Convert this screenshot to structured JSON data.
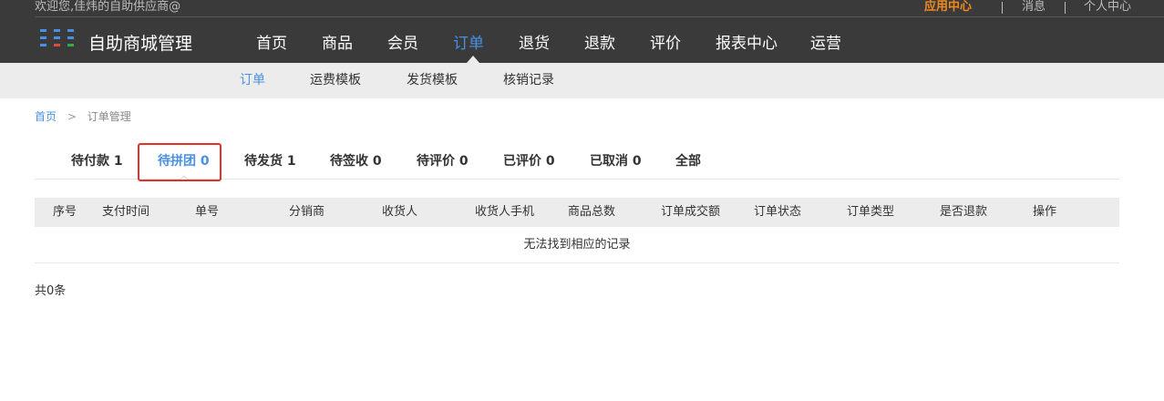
{
  "header": {
    "welcome": "欢迎您,佳炜的自助供应商@",
    "links": {
      "app_center": "应用中心",
      "messages": "消息",
      "personal_center": "个人中心"
    },
    "brand": "自助商城管理",
    "logo_colors": [
      "#4a90e2",
      "#4a90e2",
      "#4a90e2",
      "#e04b3a",
      "#3aa64a",
      "#4a90e2"
    ]
  },
  "main_nav": {
    "items": [
      "首页",
      "商品",
      "会员",
      "订单",
      "退货",
      "退款",
      "评价",
      "报表中心",
      "运营"
    ],
    "active": "订单"
  },
  "sub_nav": {
    "items": [
      "订单",
      "运费模板",
      "发货模板",
      "核销记录"
    ],
    "active": "订单"
  },
  "breadcrumb": {
    "home": "首页",
    "separator": ">",
    "current": "订单管理"
  },
  "status_tabs": {
    "items": [
      "待付款 1",
      "待拼团 0",
      "待发货 1",
      "待签收 0",
      "待评价 0",
      "已评价 0",
      "已取消 0",
      "全部"
    ],
    "active": "待拼团 0"
  },
  "table": {
    "columns": [
      "序号",
      "支付时间",
      "单号",
      "分销商",
      "收货人",
      "收货人手机",
      "商品总数",
      "订单成交额",
      "订单状态",
      "订单类型",
      "是否退款",
      "操作"
    ],
    "empty_text": "无法找到相应的记录"
  },
  "footer": {
    "total": "共0条"
  },
  "colors": {
    "accent": "#4a90e2",
    "highlight": "#e0322b",
    "app_center": "#f08a1c",
    "header_bg": "#3a3a3a"
  }
}
